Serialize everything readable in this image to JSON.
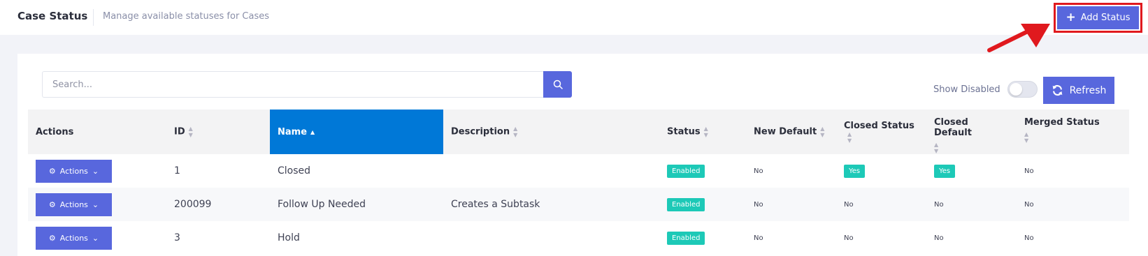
{
  "header": {
    "title": "Case Status",
    "subtitle": "Manage available statuses for Cases",
    "add_button": {
      "label": "Add Status",
      "icon": "plus-icon"
    }
  },
  "toolbar": {
    "search_placeholder": "Search...",
    "search_icon": "search-icon",
    "show_disabled_label": "Show Disabled",
    "show_disabled_on": false,
    "refresh_label": "Refresh",
    "refresh_icon": "refresh-icon"
  },
  "table": {
    "columns": [
      "Actions",
      "ID",
      "Name",
      "Description",
      "Status",
      "New Default",
      "Closed Status",
      "Closed Default",
      "Merged Status"
    ],
    "sorted_column": "Name",
    "sort_direction": "ascending",
    "rows": [
      {
        "action": "Actions",
        "id": "1",
        "name": "Closed",
        "description": "",
        "status": "Enabled",
        "new_default": "No",
        "closed_status": "Yes",
        "closed_default": "Yes",
        "merged_status": "No"
      },
      {
        "action": "Actions",
        "id": "200099",
        "name": "Follow Up Needed",
        "description": "Creates a Subtask",
        "status": "Enabled",
        "new_default": "No",
        "closed_status": "No",
        "closed_default": "No",
        "merged_status": "No"
      },
      {
        "action": "Actions",
        "id": "3",
        "name": "Hold",
        "description": "",
        "status": "Enabled",
        "new_default": "No",
        "closed_status": "No",
        "closed_default": "No",
        "merged_status": "No"
      }
    ]
  },
  "colors": {
    "primary": "#5867dd",
    "sorted_header": "#0078d7",
    "success_badge": "#1dc9b7",
    "highlight_annotation": "#e0191e"
  }
}
